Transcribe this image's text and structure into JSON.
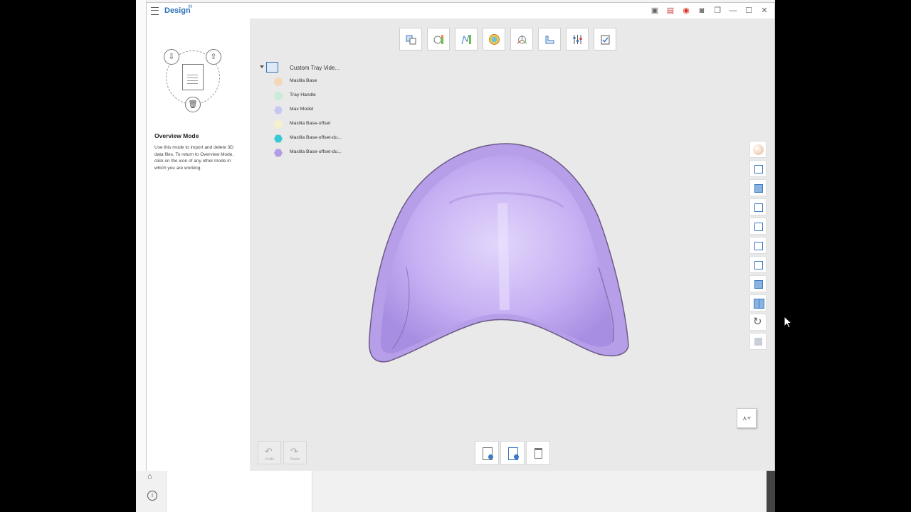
{
  "window": {
    "app_title": "Design",
    "app_badge": "H"
  },
  "overview": {
    "title": "Overview Mode",
    "description": "Use this mode to import and delete 3D data files. To return to Overview Mode, click on the icon of any other mode in which you are working."
  },
  "tree": {
    "root_label": "Custom Tray Vide...",
    "items": [
      {
        "label": "Maxilla Base",
        "color": "#f5d7b8"
      },
      {
        "label": "Tray Handle",
        "color": "#c9ecd8"
      },
      {
        "label": "Max Model",
        "color": "#c6c8f2"
      },
      {
        "label": "Maxilla Base-offset",
        "color": "#f3f1cf"
      },
      {
        "label": "Maxilla Base-offset-du...",
        "color": "#39c8d6"
      },
      {
        "label": "Maxilla Base-offset-du...",
        "color": "#b39be6"
      }
    ]
  },
  "bottom": {
    "undo_label": "Undo",
    "redo_label": "Redo"
  },
  "colors": {
    "accent": "#2a6fb5",
    "model": "#c4aef2",
    "viewport_bg": "#e9e9e9"
  }
}
